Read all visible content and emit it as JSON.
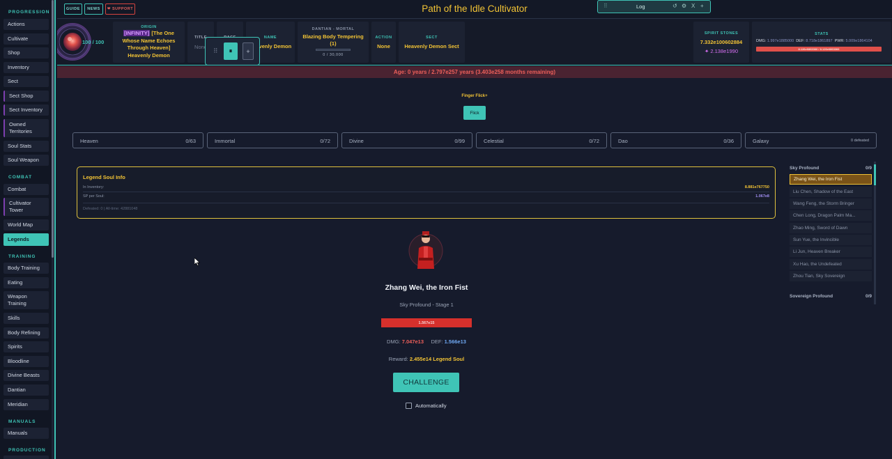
{
  "app_title": "Path of the Idle Cultivator",
  "topbar": {
    "guide": "GUIDE",
    "news": "NEWS",
    "support": "❤ SUPPORT",
    "log_label": "Log",
    "log_controls": [
      "↺",
      "⚙",
      "X",
      "+"
    ]
  },
  "sidebar": {
    "sections": {
      "progression": "PROGRESSION",
      "combat": "COMBAT",
      "training": "TRAINING",
      "manuals": "MANUALS",
      "production": "PRODUCTION"
    },
    "items": {
      "actions": "Actions",
      "cultivate": "Cultivate",
      "shop": "Shop",
      "inventory": "Inventory",
      "sect": "Sect",
      "sect_shop": "Sect Shop",
      "sect_inventory": "Sect Inventory",
      "owned_territories_1": "Owned",
      "owned_territories_2": "Territories",
      "soul_stats": "Soul Stats",
      "soul_weapon": "Soul Weapon",
      "combat": "Combat",
      "cultivator_tower_1": "Cultivator",
      "cultivator_tower_2": "Tower",
      "world_map": "World Map",
      "legends": "Legends",
      "body_training": "Body Training",
      "eating": "Eating",
      "weapon_training_1": "Weapon",
      "weapon_training_2": "Training",
      "skills": "Skills",
      "body_refining": "Body Refining",
      "spirits": "Spirits",
      "bloodline": "Bloodline",
      "divine_beasts": "Divine Beasts",
      "dantian": "Dantian",
      "meridian": "Meridian",
      "manuals": "Manuals"
    }
  },
  "stats": {
    "health": "100 / 100",
    "origin_label": "ORIGIN",
    "origin_tag": "[INFINITY]",
    "origin_line1": "[The One",
    "origin_line2": "Whose Name Echoes",
    "origin_line3": "Through Heaven]",
    "origin_line4": "Heavenly Demon",
    "title_label": "TITLE",
    "title_value": "None",
    "race_label": "RACE",
    "name_label": "NAME",
    "name_value": "Heavenly Demon",
    "dantian_label": "DANTIAN - MORTAL",
    "dantian_value_1": "Blazing Body Tempering",
    "dantian_value_2": "(1)",
    "dantian_progress": "0 / 30,000",
    "action_label": "ACTION",
    "action_value": "None",
    "sect_label": "SECT",
    "sect_value": "Heavenly Demon Sect",
    "spirit_label": "SPIRIT STONES",
    "spirit_value": "7.332e100602884",
    "spirit_secondary": "✦ 2.138e1990",
    "stats_label": "STATS",
    "dmg_label": "DMG:",
    "dmg_value": "1.997e1885000",
    "def_label": "DEF:",
    "def_value": "8.718e1861897",
    "pwr_label": "PWR:",
    "pwr_value": "5.009e1864104",
    "hp_bar_text": "8.126e6863366 / 8.126e6863366"
  },
  "age_text": "Age: 0 years / 2.797e257 years (3.403e258 months remaining)",
  "flick": {
    "label": "Finger Flick+",
    "button": "Flick"
  },
  "realms": [
    {
      "name": "Heaven",
      "count": "0/63"
    },
    {
      "name": "Immortal",
      "count": "0/72"
    },
    {
      "name": "Divine",
      "count": "0/99"
    },
    {
      "name": "Celestial",
      "count": "0/72"
    },
    {
      "name": "Dao",
      "count": "0/36"
    },
    {
      "name": "Galaxy",
      "count": "0 defeated"
    }
  ],
  "soul_info": {
    "title": "Legend Soul Info",
    "inventory_label": "In Inventory:",
    "inventory_value": "8.881e767750",
    "sp_label": "SP per Soul:",
    "sp_value": "1.067e8",
    "defeated_text": "Defeated: 0 | All-time: 42881048"
  },
  "enemy": {
    "name": "Zhang Wei, the Iron Fist",
    "stage": "Sky Profound - Stage 1",
    "hp": "1.567e15",
    "dmg_label": "DMG:",
    "dmg_value": "7.047e13",
    "def_label": "DEF:",
    "def_value": "1.566e13",
    "reward_label": "Reward:",
    "reward_value": "2.455e14 Legend Soul",
    "challenge_button": "CHALLENGE",
    "auto_label": "Automatically"
  },
  "legend_list": {
    "group1_name": "Sky Profound",
    "group1_count": "0/9",
    "items": [
      "Zhang Wei, the Iron Fist",
      "Liu Chen, Shadow of the East",
      "Wang Feng, the Storm Bringer",
      "Chen Long, Dragon Palm Ma...",
      "Zhao Ming, Sword of Dawn",
      "Sun Yue, the Invincible",
      "Li Jun, Heaven Breaker",
      "Xu Hao, the Undefeated",
      "Zhou Tian, Sky Sovereign"
    ],
    "group2_name": "Sovereign Profound",
    "group2_count": "0/9"
  },
  "colors": {
    "accent": "#3fc4b6",
    "gold": "#f2c335",
    "danger": "#d6302c",
    "background": "#161b2c",
    "purple": "#7d3fb0"
  }
}
